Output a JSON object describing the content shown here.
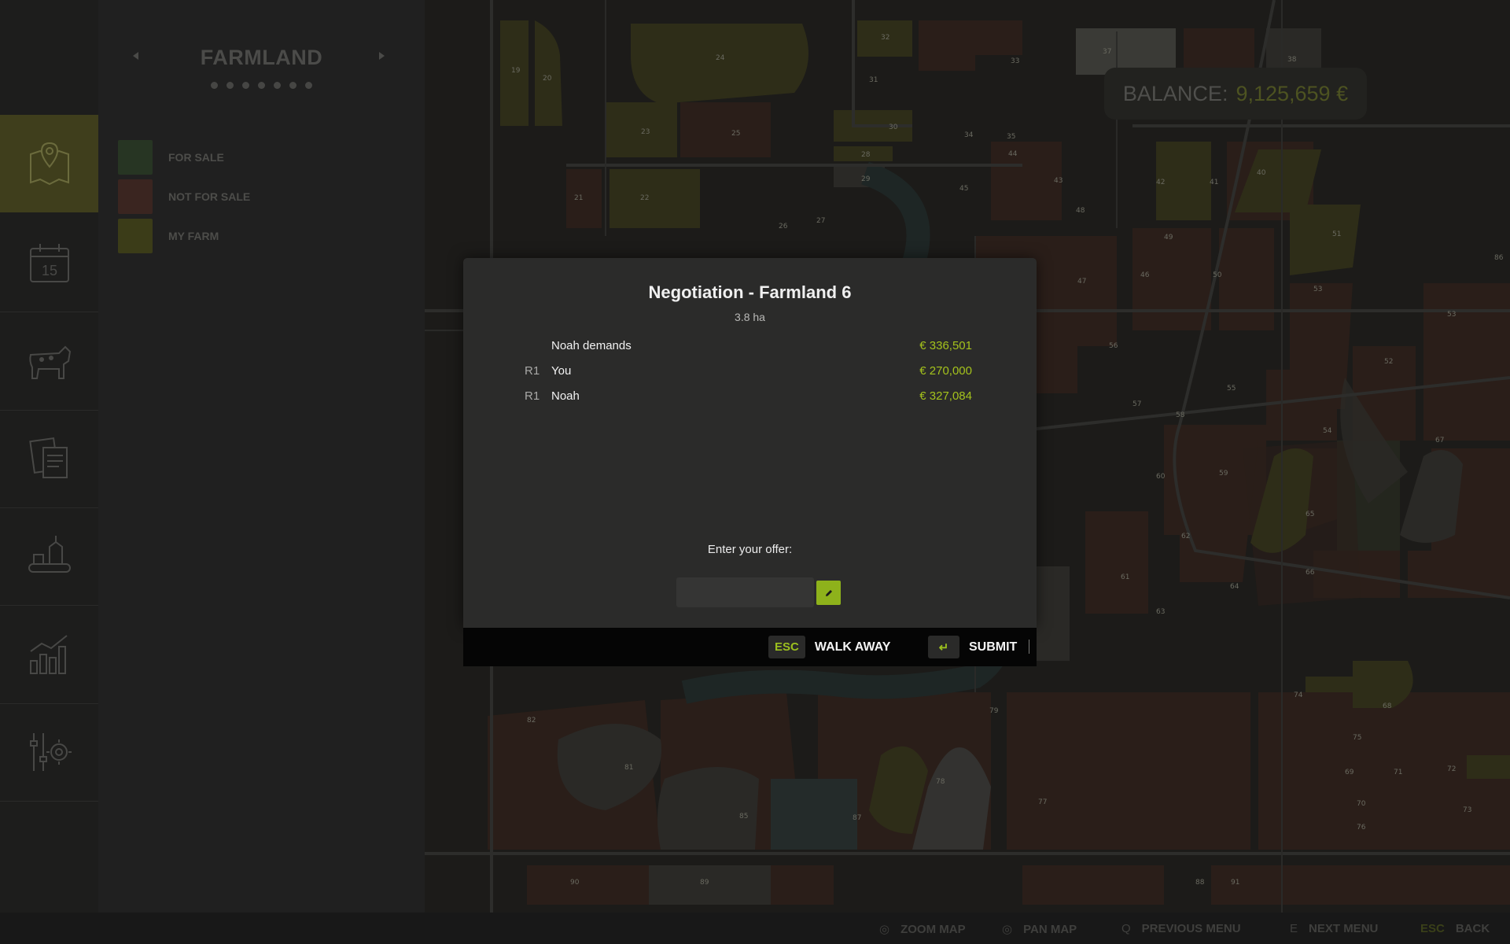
{
  "sidebar": {
    "title": "FARMLAND",
    "page_dots": 7,
    "legend": [
      {
        "label": "FOR SALE",
        "color": "#273523"
      },
      {
        "label": "NOT FOR SALE",
        "color": "#3a2520"
      },
      {
        "label": "MY FARM",
        "color": "#3b3c18"
      }
    ],
    "rail": [
      {
        "icon": "map-pin-icon",
        "active": true
      },
      {
        "icon": "calendar-icon",
        "badge": "15",
        "active": false
      },
      {
        "icon": "cow-icon",
        "active": false
      },
      {
        "icon": "contracts-icon",
        "active": false
      },
      {
        "icon": "production-icon",
        "active": false
      },
      {
        "icon": "statistics-icon",
        "active": false
      },
      {
        "icon": "settings-icon",
        "active": false
      }
    ]
  },
  "balance": {
    "label": "BALANCE:",
    "value": "9,125,659 €"
  },
  "dialog": {
    "title": "Negotiation - Farmland 6",
    "subtitle": "3.8 ha",
    "history": [
      {
        "round": "",
        "name": "Noah demands",
        "value": "€ 336,501"
      },
      {
        "round": "R1",
        "name": "You",
        "value": "€ 270,000"
      },
      {
        "round": "R1",
        "name": "Noah",
        "value": "€ 327,084"
      }
    ],
    "offer_label": "Enter your offer:",
    "offer_value": ""
  },
  "buttons": {
    "walk_away": {
      "key": "ESC",
      "label": "WALK AWAY"
    },
    "submit": {
      "key": "↵",
      "label": "SUBMIT"
    }
  },
  "bottom_hints": [
    {
      "key": "◎",
      "label": "ZOOM MAP"
    },
    {
      "key": "◎",
      "label": "PAN MAP"
    },
    {
      "key": "Q",
      "label": "PREVIOUS MENU"
    },
    {
      "key": "E",
      "label": "NEXT MENU"
    },
    {
      "key": "ESC",
      "label": "BACK"
    }
  ],
  "map_field_numbers": [
    "19",
    "20",
    "24",
    "32",
    "33",
    "37",
    "38",
    "31",
    "23",
    "25",
    "30",
    "34",
    "35",
    "28",
    "29",
    "44",
    "21",
    "22",
    "26",
    "27",
    "45",
    "43",
    "48",
    "42",
    "41",
    "40",
    "51",
    "53",
    "47",
    "46",
    "49",
    "50",
    "52",
    "54",
    "56",
    "58",
    "55",
    "57",
    "59",
    "60",
    "61",
    "62",
    "63",
    "64",
    "65",
    "66",
    "67",
    "68",
    "69",
    "70",
    "71",
    "72",
    "73",
    "74",
    "75",
    "76",
    "77",
    "78",
    "79",
    "81",
    "82",
    "85",
    "86",
    "87",
    "88",
    "89",
    "90",
    "91"
  ]
}
